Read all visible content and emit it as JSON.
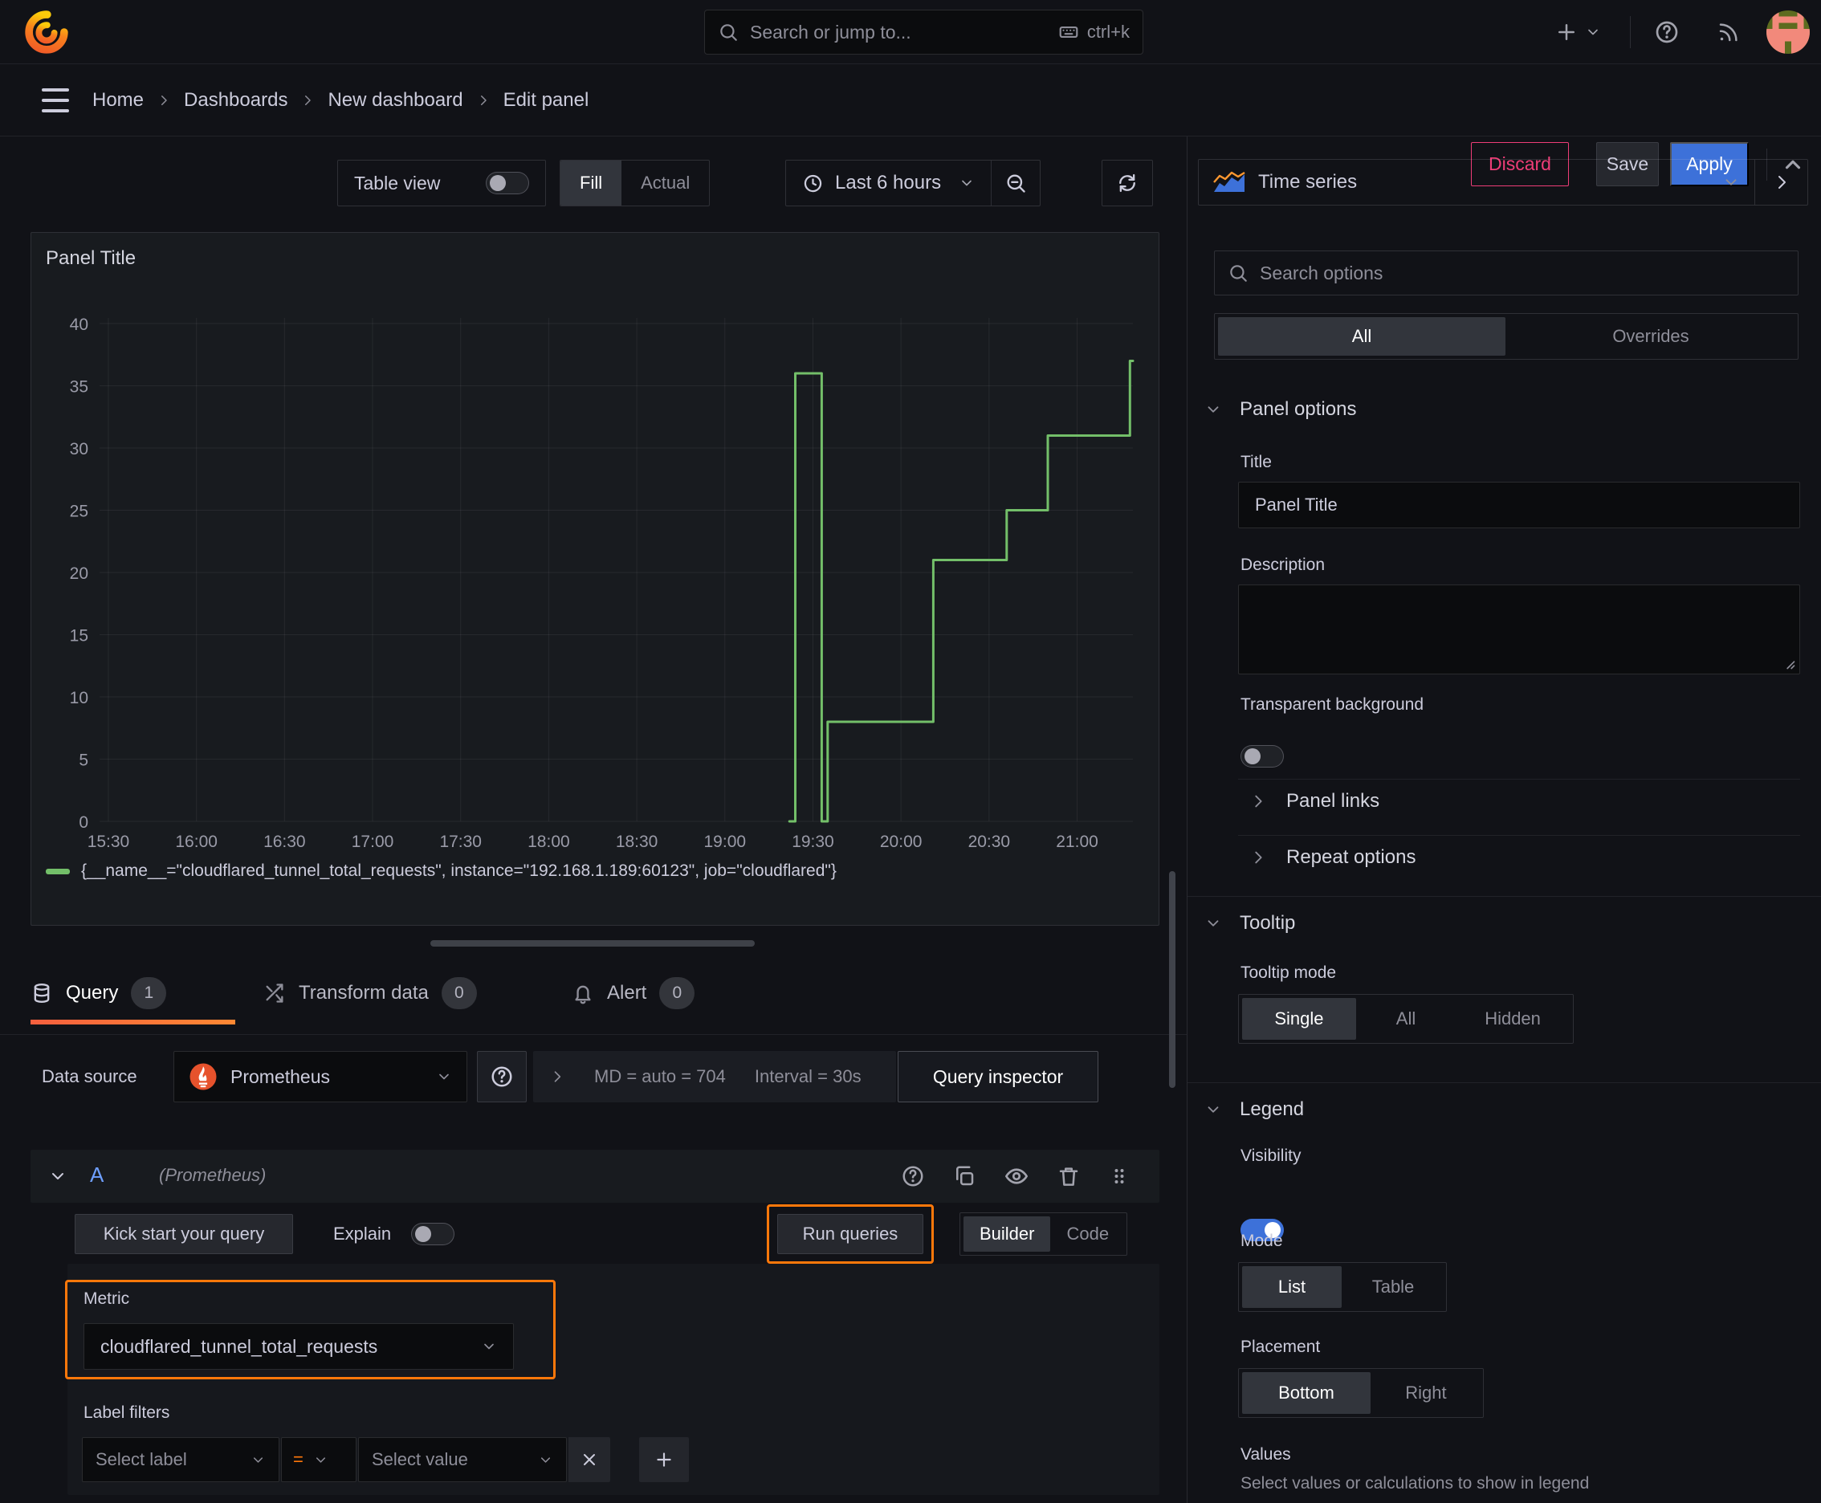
{
  "topbar": {
    "search_placeholder": "Search or jump to...",
    "search_shortcut": "ctrl+k"
  },
  "breadcrumb": {
    "items": [
      "Home",
      "Dashboards",
      "New dashboard",
      "Edit panel"
    ],
    "discard_label": "Discard",
    "save_label": "Save",
    "apply_label": "Apply"
  },
  "panel_toolbar": {
    "table_view_label": "Table view",
    "fill_label": "Fill",
    "actual_label": "Actual",
    "time_range_label": "Last 6 hours"
  },
  "panel": {
    "title": "Panel Title"
  },
  "chart_data": {
    "type": "line",
    "step": true,
    "title": "Panel Title",
    "xlabel": "",
    "ylabel": "",
    "grid": true,
    "legend_position": "bottom",
    "ylim": [
      0,
      40
    ],
    "y_ticks": [
      0,
      5,
      10,
      15,
      20,
      25,
      30,
      35,
      40
    ],
    "x_ticks": [
      "15:30",
      "16:00",
      "16:30",
      "17:00",
      "17:30",
      "18:00",
      "18:30",
      "19:00",
      "19:30",
      "20:00",
      "20:30",
      "21:00"
    ],
    "x_window": [
      "15:27",
      "21:19"
    ],
    "series": [
      {
        "name": "{__name__=\"cloudflared_tunnel_total_requests\", instance=\"192.168.1.189:60123\", job=\"cloudflared\"}",
        "color": "#73bf69",
        "points": [
          {
            "t": "19:22",
            "v": 0
          },
          {
            "t": "19:24",
            "v": 36
          },
          {
            "t": "19:33",
            "v": 0
          },
          {
            "t": "19:35",
            "v": 8
          },
          {
            "t": "20:11",
            "v": 21
          },
          {
            "t": "20:36",
            "v": 25
          },
          {
            "t": "20:50",
            "v": 31
          },
          {
            "t": "21:18",
            "v": 37
          },
          {
            "t": "21:19",
            "v": 37
          }
        ]
      }
    ]
  },
  "tabs": {
    "query_label": "Query",
    "query_count": "1",
    "transform_label": "Transform data",
    "transform_count": "0",
    "alert_label": "Alert",
    "alert_count": "0"
  },
  "datasource": {
    "label": "Data source",
    "name": "Prometheus",
    "summary_md": "MD = auto = 704",
    "summary_interval": "Interval = 30s",
    "query_inspector_label": "Query inspector"
  },
  "query": {
    "ref_id": "A",
    "datasource_hint": "(Prometheus)",
    "kick_start_label": "Kick start your query",
    "explain_label": "Explain",
    "run_queries_label": "Run queries",
    "builder_label": "Builder",
    "code_label": "Code",
    "metric_label": "Metric",
    "metric_value": "cloudflared_tunnel_total_requests",
    "label_filters_label": "Label filters",
    "select_label_placeholder": "Select label",
    "operator": "=",
    "select_value_placeholder": "Select value"
  },
  "sidebar": {
    "visualization": "Time series",
    "search_placeholder": "Search options",
    "tab_all": "All",
    "tab_overrides": "Overrides",
    "panel_options_header": "Panel options",
    "title_label": "Title",
    "title_value": "Panel Title",
    "description_label": "Description",
    "transparent_label": "Transparent background",
    "panel_links_label": "Panel links",
    "repeat_options_label": "Repeat options",
    "tooltip_header": "Tooltip",
    "tooltip_mode_label": "Tooltip mode",
    "tooltip_options": [
      "Single",
      "All",
      "Hidden"
    ],
    "tooltip_selected": "Single",
    "legend_header": "Legend",
    "visibility_label": "Visibility",
    "mode_label": "Mode",
    "mode_options": [
      "List",
      "Table"
    ],
    "mode_selected": "List",
    "placement_label": "Placement",
    "placement_options": [
      "Bottom",
      "Right"
    ],
    "placement_selected": "Bottom",
    "values_label": "Values",
    "values_help": "Select values or calculations to show in legend"
  },
  "colors": {
    "background": "#111217",
    "panel": "#181b1f",
    "border": "rgba(204,204,220,0.16)",
    "text": "#ccccdc",
    "text_dim": "#8e8e99",
    "accent_blue": "#3d71d9",
    "accent_orange": "#ff780a",
    "series_green": "#73bf69",
    "discard_red": "#ee3d77",
    "prometheus_orange": "#e6522c",
    "tab_underline_gradient": [
      "#f55f3e",
      "#ff8833"
    ]
  }
}
